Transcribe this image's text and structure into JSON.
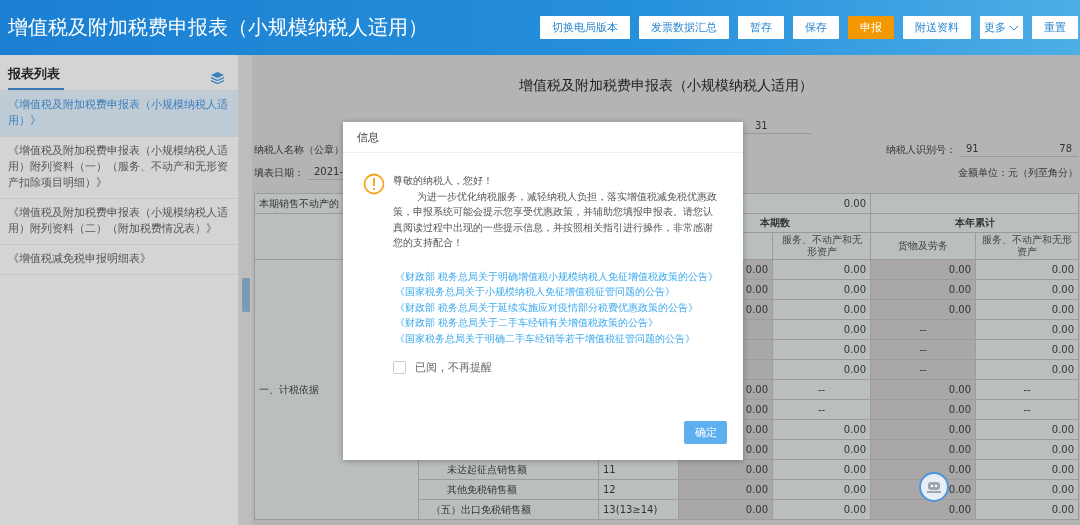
{
  "header": {
    "title": "增值税及附加税费申报表（小规模纳税人适用）",
    "buttons": [
      {
        "label": "切换电局版本",
        "kind": "default"
      },
      {
        "label": "发票数据汇总",
        "kind": "default"
      },
      {
        "label": "暂存",
        "kind": "default"
      },
      {
        "label": "保存",
        "kind": "default"
      },
      {
        "label": "申报",
        "kind": "primary"
      },
      {
        "label": "附送资料",
        "kind": "default"
      },
      {
        "label": "更多",
        "kind": "menu"
      },
      {
        "label": "重置",
        "kind": "default"
      }
    ]
  },
  "sidebar": {
    "title": "报表列表",
    "items": [
      {
        "label": "《增值税及附加税费申报表（小规模纳税人适用）》",
        "selected": true
      },
      {
        "label": "《增值税及附加税费申报表（小规模纳税人适用）附列资料（一）（服务、不动产和无形资产扣除项目明细）》",
        "selected": false
      },
      {
        "label": "《增值税及附加税费申报表（小规模纳税人适用）附列资料（二）（附加税费情况表）》",
        "selected": false
      },
      {
        "label": "《增值税减免税申报明细表》",
        "selected": false
      }
    ]
  },
  "form": {
    "title": "增值税及附加税费申报表（小规模纳税人适用）",
    "period_value": "31",
    "taxpayer_name_label": "纳税人名称（公章）",
    "taxpayer_id_label": "纳税人识别号：",
    "taxpayer_id_start": "91",
    "taxpayer_id_end": "78",
    "date_label": "填表日期：",
    "date_value": "2021-",
    "unit": "金额单位：元（列至角分）",
    "table": {
      "top_row": {
        "label": "本期销售不动产的",
        "value": "0.00"
      },
      "groups": [
        "本期数",
        "本年累计"
      ],
      "columns": [
        "服务、不动产和无形资产",
        "货物及劳务",
        "服务、不动产和无形资产"
      ],
      "section": "一、计税依据",
      "rows": [
        {
          "values": [
            {
              "text": "0.00",
              "kind": "amount"
            },
            {
              "text": "0.00",
              "kind": "amount"
            },
            {
              "text": "0.00",
              "kind": "amount"
            },
            {
              "text": "0.00",
              "kind": "amount"
            }
          ]
        },
        {
          "values": [
            {
              "text": "0.00",
              "kind": "amount"
            },
            {
              "text": "0.00",
              "kind": "amount"
            },
            {
              "text": "0.00",
              "kind": "amount"
            },
            {
              "text": "0.00",
              "kind": "amount"
            }
          ]
        },
        {
          "values": [
            {
              "text": "0.00",
              "kind": "amount"
            },
            {
              "text": "0.00",
              "kind": "amount"
            },
            {
              "text": "0.00",
              "kind": "amount"
            },
            {
              "text": "0.00",
              "kind": "amount"
            }
          ]
        },
        {
          "values": [
            {
              "kind": "blank"
            },
            {
              "text": "0.00",
              "kind": "amount"
            },
            {
              "text": "--",
              "kind": "na"
            },
            {
              "text": "0.00",
              "kind": "amount"
            }
          ]
        },
        {
          "values": [
            {
              "kind": "blank"
            },
            {
              "text": "0.00",
              "kind": "amount"
            },
            {
              "text": "--",
              "kind": "na"
            },
            {
              "text": "0.00",
              "kind": "amount"
            }
          ]
        },
        {
          "values": [
            {
              "kind": "blank"
            },
            {
              "text": "0.00",
              "kind": "amount"
            },
            {
              "text": "--",
              "kind": "na"
            },
            {
              "text": "0.00",
              "kind": "amount"
            }
          ]
        },
        {
          "values": [
            {
              "text": "0.00",
              "kind": "amount"
            },
            {
              "text": "--",
              "kind": "na"
            },
            {
              "text": "0.00",
              "kind": "amount"
            },
            {
              "text": "--",
              "kind": "na"
            }
          ]
        },
        {
          "values": [
            {
              "text": "0.00",
              "kind": "amount"
            },
            {
              "text": "--",
              "kind": "na"
            },
            {
              "text": "0.00",
              "kind": "amount"
            },
            {
              "text": "--",
              "kind": "na"
            }
          ]
        },
        {
          "values": [
            {
              "text": "0.00",
              "kind": "amount"
            },
            {
              "text": "0.00",
              "kind": "amount"
            },
            {
              "text": "0.00",
              "kind": "amount"
            },
            {
              "text": "0.00",
              "kind": "amount"
            }
          ]
        },
        {
          "values": [
            {
              "text": "0.00",
              "kind": "amount"
            },
            {
              "text": "0.00",
              "kind": "amount"
            },
            {
              "text": "0.00",
              "kind": "amount"
            },
            {
              "text": "0.00",
              "kind": "amount"
            }
          ]
        },
        {
          "item": "未达起征点销售额",
          "line": "11",
          "values": [
            {
              "text": "0.00",
              "kind": "amount"
            },
            {
              "text": "0.00",
              "kind": "amount"
            },
            {
              "text": "0.00",
              "kind": "amount"
            },
            {
              "text": "0.00",
              "kind": "amount"
            }
          ]
        },
        {
          "item": "其他免税销售额",
          "line": "12",
          "values": [
            {
              "text": "0.00",
              "kind": "amount"
            },
            {
              "text": "0.00",
              "kind": "amount"
            },
            {
              "text": "0.00",
              "kind": "amount"
            },
            {
              "text": "0.00",
              "kind": "amount"
            }
          ]
        },
        {
          "item": "（五）出口免税销售额",
          "line": "13(13≥14)",
          "outdent": true,
          "values": [
            {
              "text": "0.00",
              "kind": "amount"
            },
            {
              "text": "0.00",
              "kind": "amount"
            },
            {
              "text": "0.00",
              "kind": "amount"
            },
            {
              "text": "0.00",
              "kind": "amount"
            }
          ]
        }
      ]
    }
  },
  "dialog": {
    "title": "信息",
    "greeting": "尊敬的纳税人，您好！",
    "message": "为进一步优化纳税服务，减轻纳税人负担，落实增值税减免税优惠政策，申报系统可能会提示您享受优惠政策，并辅助您填报申报表。请您认真阅读过程中出现的一些提示信息，并按照相关指引进行操作，非常感谢您的支持配合！",
    "links": [
      "《财政部 税务总局关于明确增值税小规模纳税人免征增值税政策的公告》",
      "《国家税务总局关于小规模纳税人免征增值税征管问题的公告》",
      "《财政部 税务总局关于延续实施应对疫情部分税费优惠政策的公告》",
      "《财政部 税务总局关于二手车经销有关增值税政策的公告》",
      "《国家税务总局关于明确二手车经销等若干增值税征管问题的公告》"
    ],
    "dont_remind": {
      "label": "已阅，不再提醒",
      "checked": false
    },
    "confirm": "确定"
  }
}
